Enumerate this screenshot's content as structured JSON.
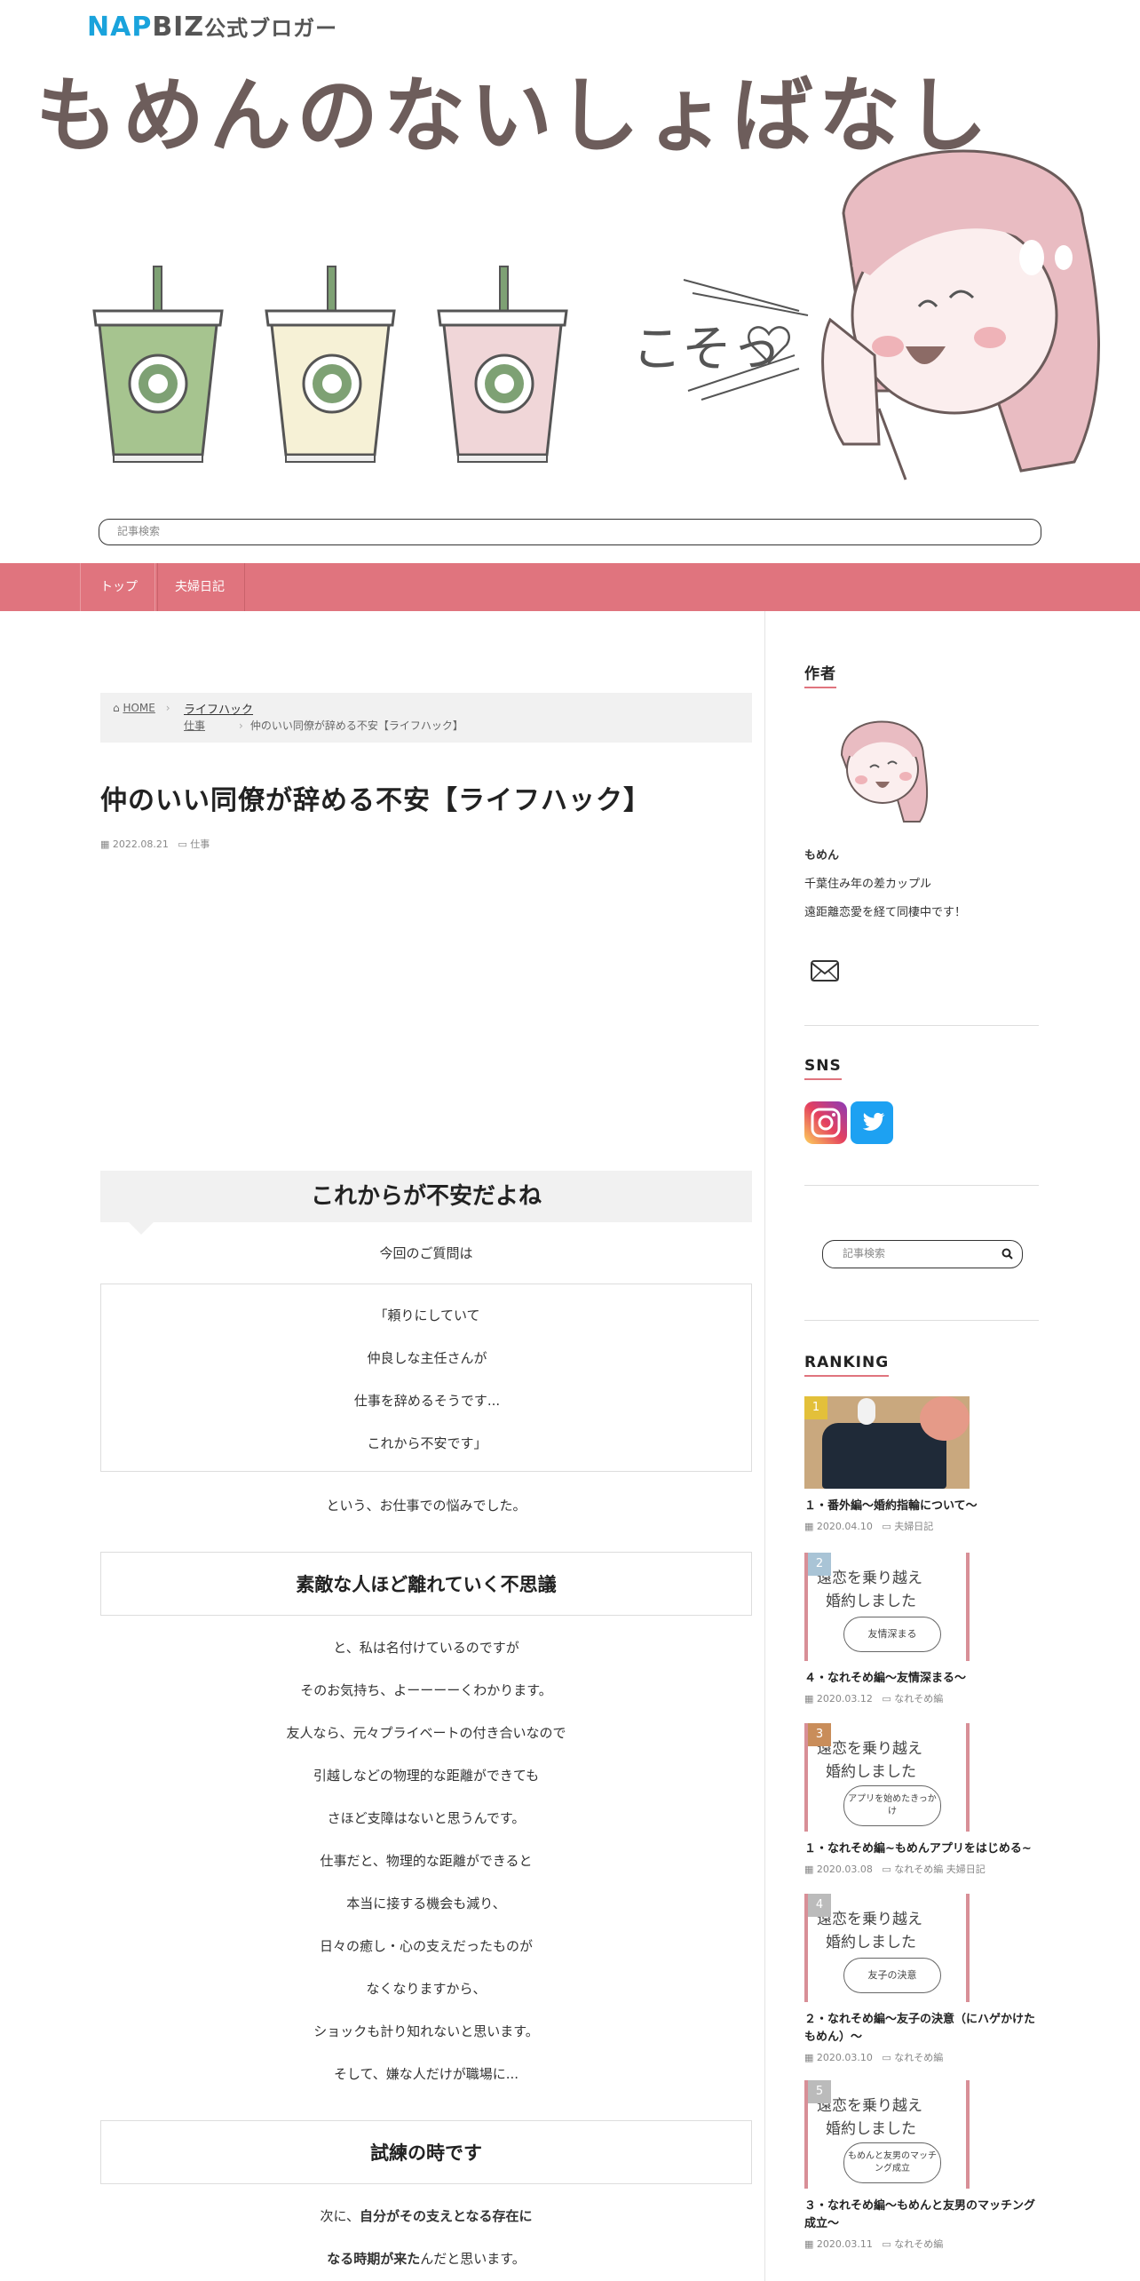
{
  "header": {
    "napbiz_nap": "NAP",
    "napbiz_biz": "BIZ",
    "napbiz_jp": "公式ブロガー",
    "site_title": "もめんのないしょばなし",
    "illustration_text": "こそっ",
    "search_placeholder": "記事検索"
  },
  "nav": {
    "items": [
      {
        "label": "トップ"
      },
      {
        "label": "夫婦日記"
      }
    ]
  },
  "breadcrumb": {
    "home": "HOME",
    "level1": "ライフハック",
    "level2": "仕事",
    "current": "仲のいい同僚が辞める不安【ライフハック】"
  },
  "post": {
    "title": "仲のいい同僚が辞める不安【ライフハック】",
    "date": "2022.08.21",
    "category": "仕事",
    "h2": "これからが不安だよね",
    "intro": "今回のご質問は",
    "quote_lines": [
      "「頼りにしていて",
      "仲良しな主任さんが",
      "仕事を辞めるそうです...",
      "これから不安です」"
    ],
    "after_quote": "という、お仕事での悩みでした。",
    "h3_1": "素敵な人ほど離れていく不思議",
    "body_lines": [
      "と、私は名付けているのですが",
      "そのお気持ち、よーーーーくわかります。",
      "友人なら、元々プライベートの付き合いなので",
      "引越しなどの物理的な距離ができても",
      "さほど支障はないと思うんです。",
      "仕事だと、物理的な距離ができると",
      "本当に接する機会も減り、",
      "日々の癒し・心の支えだったものが",
      "なくなりますから、",
      "ショックも計り知れないと思います。",
      "そして、嫌な人だけが職場に..."
    ],
    "h3_2": "試練の時です",
    "tail_line1_a": "次に、",
    "tail_line1_b": "自分がその支えとなる存在に",
    "tail_line2_a": "なる時期が来た",
    "tail_line2_b": "んだと思います。"
  },
  "sidebar": {
    "author_title": "作者",
    "author_name": "もめん",
    "author_desc1": "千葉住み年の差カップル",
    "author_desc2": "遠距離恋愛を経て同棲中です！",
    "sns_title": "SNS",
    "search_placeholder": "記事検索",
    "ranking_title": "RANKING",
    "ranking": [
      {
        "num": "1",
        "title": "１・番外編～婚約指輪について～",
        "date": "2020.04.10",
        "cats": "夫婦日記",
        "color": "#e3c03a"
      },
      {
        "num": "2",
        "title": "４・なれそめ編～友情深まる～",
        "date": "2020.03.12",
        "cats": "なれそめ編",
        "color": "#a9c4d6"
      },
      {
        "num": "3",
        "title": "１・なれそめ編~もめんアプリをはじめる~",
        "date": "2020.03.08",
        "cats": "なれそめ編 夫婦日記",
        "color": "#c98d5a"
      },
      {
        "num": "4",
        "title": "２・なれそめ編～友子の決意（にハゲかけたもめん）～",
        "date": "2020.03.10",
        "cats": "なれそめ編",
        "color": "#bbbbbb"
      },
      {
        "num": "5",
        "title": "３・なれそめ編～もめんと友男のマッチング成立～",
        "date": "2020.03.11",
        "cats": "なれそめ編",
        "color": "#bbbbbb"
      }
    ],
    "thumb_text": {
      "l1": "遠恋を乗り越え",
      "l2": "婚約しました",
      "bubble2": "友情深まる",
      "bubble3": "アプリを始めたきっかけ",
      "bubble4": "友子の決意",
      "bubble5": "もめんと友男のマッチング成立"
    }
  }
}
